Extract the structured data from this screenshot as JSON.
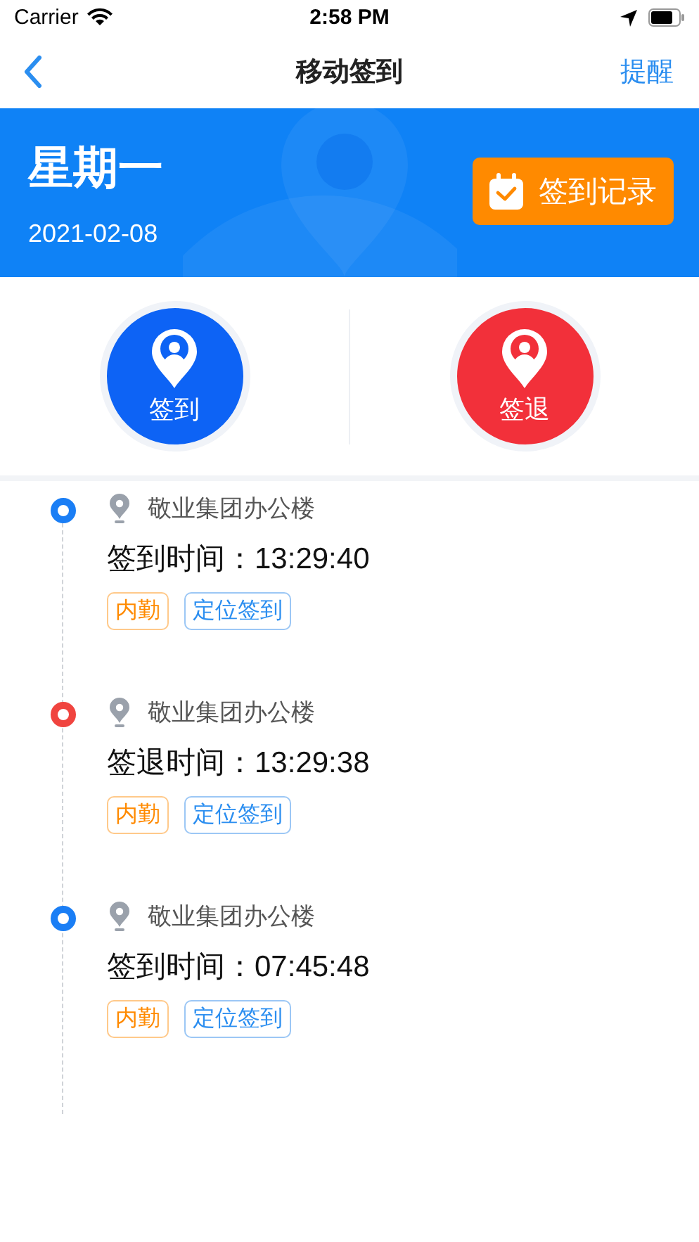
{
  "status_bar": {
    "carrier": "Carrier",
    "time": "2:58 PM"
  },
  "nav": {
    "title": "移动签到",
    "action": "提醒"
  },
  "banner": {
    "weekday": "星期一",
    "date": "2021-02-08",
    "button": "签到记录"
  },
  "actions": [
    {
      "kind": "in",
      "label": "签到"
    },
    {
      "kind": "out",
      "label": "签退"
    }
  ],
  "records": [
    {
      "kind": "in",
      "place": "敬业集团办公楼",
      "time": "签到时间：13:29:40",
      "tags": [
        {
          "kind": "type",
          "label": "内勤"
        },
        {
          "kind": "method",
          "label": "定位签到"
        }
      ]
    },
    {
      "kind": "out",
      "place": "敬业集团办公楼",
      "time": "签退时间：13:29:38",
      "tags": [
        {
          "kind": "type",
          "label": "内勤"
        },
        {
          "kind": "method",
          "label": "定位签到"
        }
      ]
    },
    {
      "kind": "in",
      "place": "敬业集团办公楼",
      "time": "签到时间：07:45:48",
      "tags": [
        {
          "kind": "type",
          "label": "内勤"
        },
        {
          "kind": "method",
          "label": "定位签到"
        }
      ]
    }
  ]
}
